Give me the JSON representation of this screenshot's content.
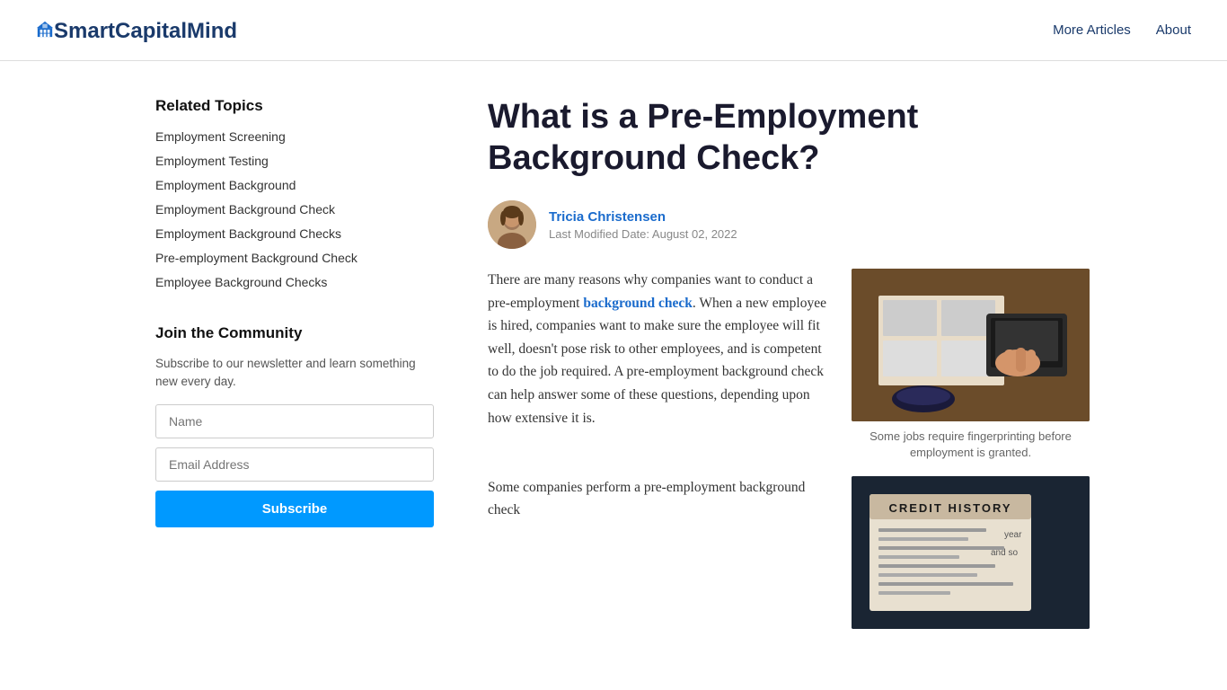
{
  "header": {
    "logo_text_bold": "SmartCapitalMind",
    "logo_text_light": "",
    "nav_items": [
      {
        "label": "More Articles",
        "href": "#"
      },
      {
        "label": "About",
        "href": "#"
      }
    ]
  },
  "sidebar": {
    "related_topics_heading": "Related Topics",
    "related_links": [
      {
        "label": "Employment Screening",
        "href": "#"
      },
      {
        "label": "Employment Testing",
        "href": "#"
      },
      {
        "label": "Employment Background",
        "href": "#"
      },
      {
        "label": "Employment Background Check",
        "href": "#"
      },
      {
        "label": "Employment Background Checks",
        "href": "#"
      },
      {
        "label": "Pre-employment Background Check",
        "href": "#"
      },
      {
        "label": "Employee Background Checks",
        "href": "#"
      }
    ],
    "join_heading": "Join the Community",
    "join_desc": "Subscribe to our newsletter and learn something new every day.",
    "name_placeholder": "Name",
    "email_placeholder": "Email Address",
    "subscribe_label": "Subscribe"
  },
  "article": {
    "title": "What is a Pre-Employment Background Check?",
    "author_name": "Tricia Christensen",
    "last_modified_label": "Last Modified Date:",
    "last_modified_date": "August 02, 2022",
    "image1_caption": "Some jobs require fingerprinting before employment is granted.",
    "image2_alt": "Credit history document",
    "body_p1_start": "There are many reasons why companies want to conduct a pre-employment ",
    "body_link": "background check",
    "body_p1_end": ". When a new employee is hired, companies want to make sure the employee will fit well, doesn't pose risk to other employees, and is competent to do the job required. A pre-employment background check can help answer some of these questions, depending upon how extensive it is.",
    "body_p2": "Some companies perform a pre-employment background check"
  }
}
